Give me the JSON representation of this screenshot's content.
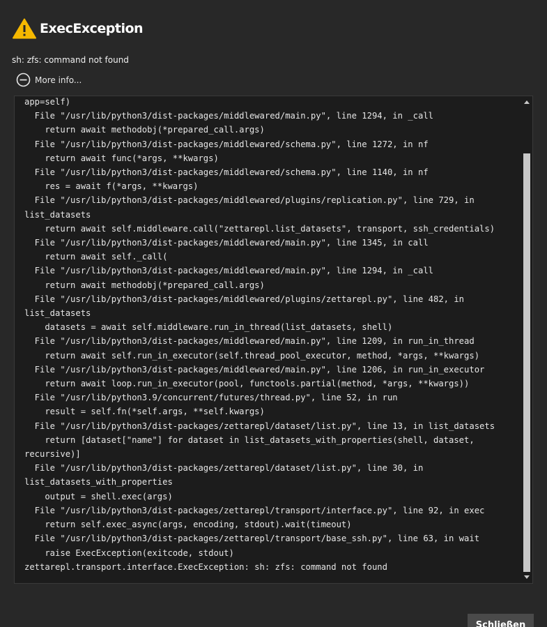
{
  "dialog": {
    "title": "ExecException",
    "message": "sh: zfs: command not found",
    "more_info_label": "More info...",
    "close_label": "Schließen",
    "icon": "warning-icon",
    "colors": {
      "warning": "#f5b800",
      "background": "#282828",
      "trace_background": "#1c1c1c",
      "button": "#4a4a4a"
    }
  },
  "trace": {
    "lines": [
      "app=self)",
      "  File \"/usr/lib/python3/dist-packages/middlewared/main.py\", line 1294, in _call",
      "    return await methodobj(*prepared_call.args)",
      "  File \"/usr/lib/python3/dist-packages/middlewared/schema.py\", line 1272, in nf",
      "    return await func(*args, **kwargs)",
      "  File \"/usr/lib/python3/dist-packages/middlewared/schema.py\", line 1140, in nf",
      "    res = await f(*args, **kwargs)",
      "  File \"/usr/lib/python3/dist-packages/middlewared/plugins/replication.py\", line 729, in",
      "list_datasets",
      "    return await self.middleware.call(\"zettarepl.list_datasets\", transport, ssh_credentials)",
      "  File \"/usr/lib/python3/dist-packages/middlewared/main.py\", line 1345, in call",
      "    return await self._call(",
      "  File \"/usr/lib/python3/dist-packages/middlewared/main.py\", line 1294, in _call",
      "    return await methodobj(*prepared_call.args)",
      "  File \"/usr/lib/python3/dist-packages/middlewared/plugins/zettarepl.py\", line 482, in",
      "list_datasets",
      "    datasets = await self.middleware.run_in_thread(list_datasets, shell)",
      "  File \"/usr/lib/python3/dist-packages/middlewared/main.py\", line 1209, in run_in_thread",
      "    return await self.run_in_executor(self.thread_pool_executor, method, *args, **kwargs)",
      "  File \"/usr/lib/python3/dist-packages/middlewared/main.py\", line 1206, in run_in_executor",
      "    return await loop.run_in_executor(pool, functools.partial(method, *args, **kwargs))",
      "  File \"/usr/lib/python3.9/concurrent/futures/thread.py\", line 52, in run",
      "    result = self.fn(*self.args, **self.kwargs)",
      "  File \"/usr/lib/python3/dist-packages/zettarepl/dataset/list.py\", line 13, in list_datasets",
      "    return [dataset[\"name\"] for dataset in list_datasets_with_properties(shell, dataset,",
      "recursive)]",
      "  File \"/usr/lib/python3/dist-packages/zettarepl/dataset/list.py\", line 30, in",
      "list_datasets_with_properties",
      "    output = shell.exec(args)",
      "  File \"/usr/lib/python3/dist-packages/zettarepl/transport/interface.py\", line 92, in exec",
      "    return self.exec_async(args, encoding, stdout).wait(timeout)",
      "  File \"/usr/lib/python3/dist-packages/zettarepl/transport/base_ssh.py\", line 63, in wait",
      "    raise ExecException(exitcode, stdout)",
      "zettarepl.transport.interface.ExecException: sh: zfs: command not found"
    ]
  }
}
